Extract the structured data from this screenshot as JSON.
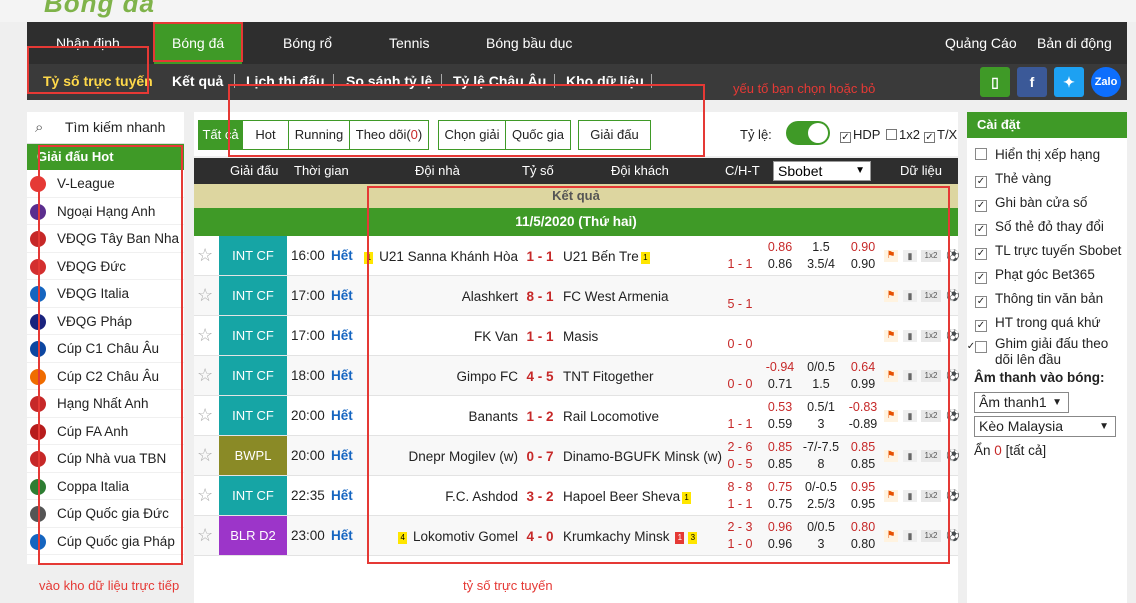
{
  "logo": "Bóng đá",
  "topnav": {
    "items": [
      "Nhận định",
      "Bóng đá",
      "Bóng rổ",
      "Tennis",
      "Bóng bầu dục"
    ],
    "right": [
      "Quảng Cáo",
      "Bản di động"
    ]
  },
  "subnav": {
    "items": [
      "Tỷ số trực tuyến",
      "Kết quả",
      "Lịch thi đấu",
      "So sánh tỷ lệ",
      "Tỷ lệ Châu Âu",
      "Kho dữ liệu"
    ]
  },
  "social": [
    "Zalo"
  ],
  "annotations": {
    "filter": "yếu tố bạn chọn hoặc bỏ",
    "data": "vào kho dữ liệu trực tiếp",
    "live": "tỷ số trực tuyến"
  },
  "left": {
    "search": "Tìm kiếm nhanh",
    "hot_title": "Giải đấu Hot",
    "leagues": [
      "V-League",
      "Ngoại Hạng Anh",
      "VĐQG Tây Ban Nha",
      "VĐQG Đức",
      "VĐQG Italia",
      "VĐQG Pháp",
      "Cúp C1 Châu Âu",
      "Cúp C2 Châu Âu",
      "Hạng Nhất Anh",
      "Cúp FA Anh",
      "Cúp Nhà vua TBN",
      "Coppa Italia",
      "Cúp Quốc gia Đức",
      "Cúp Quốc gia Pháp"
    ]
  },
  "filter": {
    "tabs": [
      "Tất cả",
      "Hot",
      "Running",
      "Theo dõi(",
      "0",
      ")"
    ],
    "buttons": [
      "Chọn giải",
      "Quốc gia",
      "Giải đấu"
    ],
    "odds_label": "Tỷ lệ:",
    "checks": [
      "HDP",
      "1x2",
      "T/X"
    ]
  },
  "table": {
    "headers": [
      "Giải đấu",
      "Thời gian",
      "Đội nhà",
      "Tỷ số",
      "Đội khách",
      "C/H-T",
      "Dữ liệu"
    ],
    "bookmaker": "Sbobet",
    "result_label": "Kết quả",
    "date": "11/5/2020 (Thứ hai)",
    "rows": [
      {
        "league": "INT CF",
        "color": "#16a5a5",
        "time": "16:00",
        "status": "Hết",
        "home": "U21 Sanna Khánh Hòa",
        "home_card": "1",
        "score": "1 - 1",
        "away": "U21 Bến Tre",
        "away_card": "1",
        "ch_top": "",
        "ch_bot": "1 - 1",
        "o1t": "0.86",
        "o2t": "1.5",
        "o3t": "0.90",
        "o1b": "0.86",
        "o2b": "3.5/4",
        "o3b": "0.90"
      },
      {
        "league": "INT CF",
        "color": "#16a5a5",
        "time": "17:00",
        "status": "Hết",
        "home": "Alashkert",
        "home_card": "",
        "score": "8 - 1",
        "away": "FC West Armenia",
        "away_card": "",
        "ch_top": "",
        "ch_bot": "5 - 1",
        "o1t": "",
        "o2t": "",
        "o3t": "",
        "o1b": "",
        "o2b": "",
        "o3b": ""
      },
      {
        "league": "INT CF",
        "color": "#16a5a5",
        "time": "17:00",
        "status": "Hết",
        "home": "FK Van",
        "home_card": "",
        "score": "1 - 1",
        "away": "Masis",
        "away_card": "",
        "ch_top": "",
        "ch_bot": "0 - 0",
        "o1t": "",
        "o2t": "",
        "o3t": "",
        "o1b": "",
        "o2b": "",
        "o3b": ""
      },
      {
        "league": "INT CF",
        "color": "#16a5a5",
        "time": "18:00",
        "status": "Hết",
        "home": "Gimpo FC",
        "home_card": "",
        "score": "4 - 5",
        "away": "TNT Fitogether",
        "away_card": "",
        "ch_top": "",
        "ch_bot": "0 - 0",
        "o1t": "-0.94",
        "o2t": "0/0.5",
        "o3t": "0.64",
        "o1b": "0.71",
        "o2b": "1.5",
        "o3b": "0.99"
      },
      {
        "league": "INT CF",
        "color": "#16a5a5",
        "time": "20:00",
        "status": "Hết",
        "home": "Banants",
        "home_card": "",
        "score": "1 - 2",
        "away": "Rail Locomotive",
        "away_card": "",
        "ch_top": "",
        "ch_bot": "1 - 1",
        "o1t": "0.53",
        "o2t": "0.5/1",
        "o3t": "-0.83",
        "o1b": "0.59",
        "o2b": "3",
        "o3b": "-0.89"
      },
      {
        "league": "BWPL",
        "color": "#8a8a26",
        "time": "20:00",
        "status": "Hết",
        "home": "Dnepr Mogilev (w)",
        "home_card": "",
        "score": "0 - 7",
        "away": "Dinamo-BGUFK Minsk (w)",
        "away_card": "",
        "ch_top": "2 - 6",
        "ch_bot": "0 - 5",
        "o1t": "0.85",
        "o2t": "-7/-7.5",
        "o3t": "0.85",
        "o1b": "0.85",
        "o2b": "8",
        "o3b": "0.85"
      },
      {
        "league": "INT CF",
        "color": "#16a5a5",
        "time": "22:35",
        "status": "Hết",
        "home": "F.C. Ashdod",
        "home_card": "",
        "score": "3 - 2",
        "away": "Hapoel Beer Sheva",
        "away_card": "1",
        "ch_top": "8 - 8",
        "ch_bot": "1 - 1",
        "o1t": "0.75",
        "o2t": "0/-0.5",
        "o3t": "0.95",
        "o1b": "0.75",
        "o2b": "2.5/3",
        "o3b": "0.95"
      },
      {
        "league": "BLR D2",
        "color": "#9c35c9",
        "time": "23:00",
        "status": "Hết",
        "home": "Lokomotiv Gomel",
        "home_card_left": "4",
        "score": "4 - 0",
        "away": "Krumkachy Minsk",
        "away_red": "1",
        "away_card": "3",
        "ch_top": "2 - 3",
        "ch_bot": "1 - 0",
        "o1t": "0.96",
        "o2t": "0/0.5",
        "o3t": "0.80",
        "o1b": "0.96",
        "o2b": "3",
        "o3b": "0.80"
      }
    ]
  },
  "settings": {
    "title": "Cài đặt",
    "options": [
      {
        "label": "Hiển thị xếp hạng",
        "checked": false
      },
      {
        "label": "Thẻ vàng",
        "checked": true
      },
      {
        "label": "Ghi bàn cửa số",
        "checked": true
      },
      {
        "label": "Số thẻ đỏ thay đổi",
        "checked": true
      },
      {
        "label": "TL trực tuyến Sbobet",
        "checked": true
      },
      {
        "label": "Phạt góc Bet365",
        "checked": true
      },
      {
        "label": "Thông tin văn bản",
        "checked": true
      },
      {
        "label": "HT trong quá khứ",
        "checked": true
      },
      {
        "label": "Ghim giải đấu theo dõi lên đầu",
        "checked": true
      }
    ],
    "sound_label": "Âm thanh vào bóng:",
    "sound_value": "Âm thanh1",
    "odds_type": "Kèo Malaysia",
    "hidden_prefix": "Ẩn",
    "hidden_count": "0",
    "hidden_suffix": "[tất cả]"
  }
}
